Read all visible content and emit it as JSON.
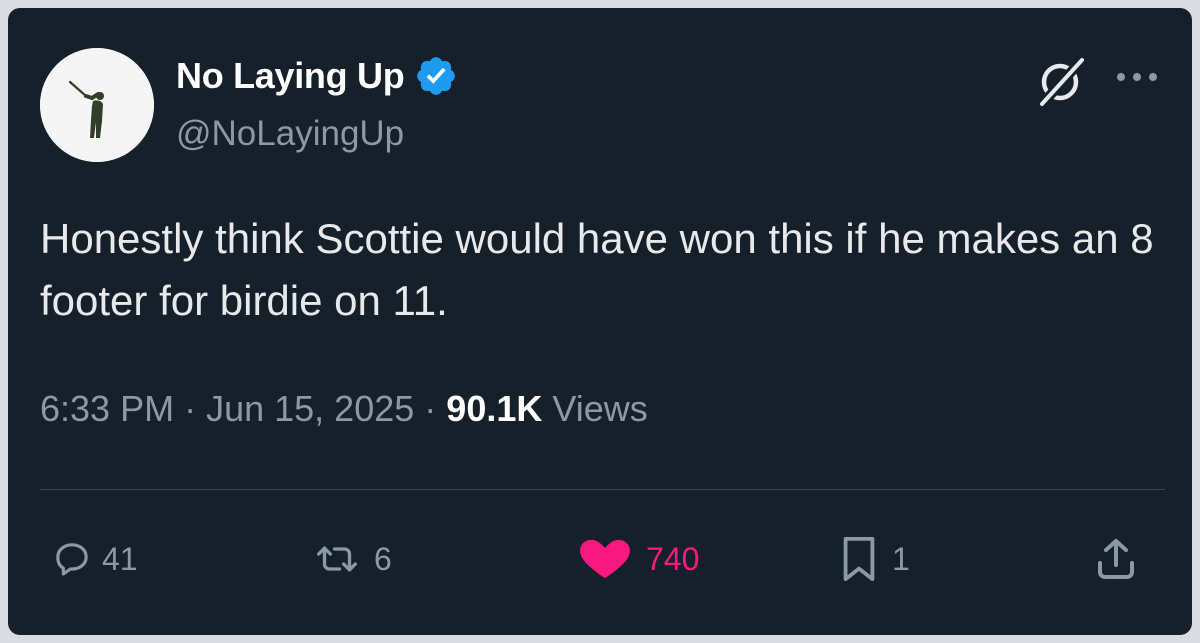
{
  "author": {
    "display_name": "No Laying Up",
    "handle": "@NoLayingUp",
    "verified": true
  },
  "tweet": {
    "text": "Honestly think Scottie would have won this if he makes an 8 footer for birdie on 11.",
    "time": "6:33 PM",
    "date": "Jun 15, 2025",
    "views_count": "90.1K",
    "views_label": "Views"
  },
  "actions": {
    "replies": "41",
    "retweets": "6",
    "likes": "740",
    "bookmarks": "1"
  },
  "icons": {
    "avatar": "golfer-silhouette",
    "verified": "verified-badge-icon",
    "grok": "grok-icon",
    "more": "more-icon",
    "reply": "reply-icon",
    "retweet": "retweet-icon",
    "like": "heart-icon",
    "bookmark": "bookmark-icon",
    "share": "share-icon"
  },
  "colors": {
    "background": "#15202b",
    "primary_text": "#e7e9ea",
    "secondary_text": "#8b98a5",
    "verified_blue": "#1d9bf0",
    "like_pink": "#f91880",
    "divider": "#38444d"
  }
}
